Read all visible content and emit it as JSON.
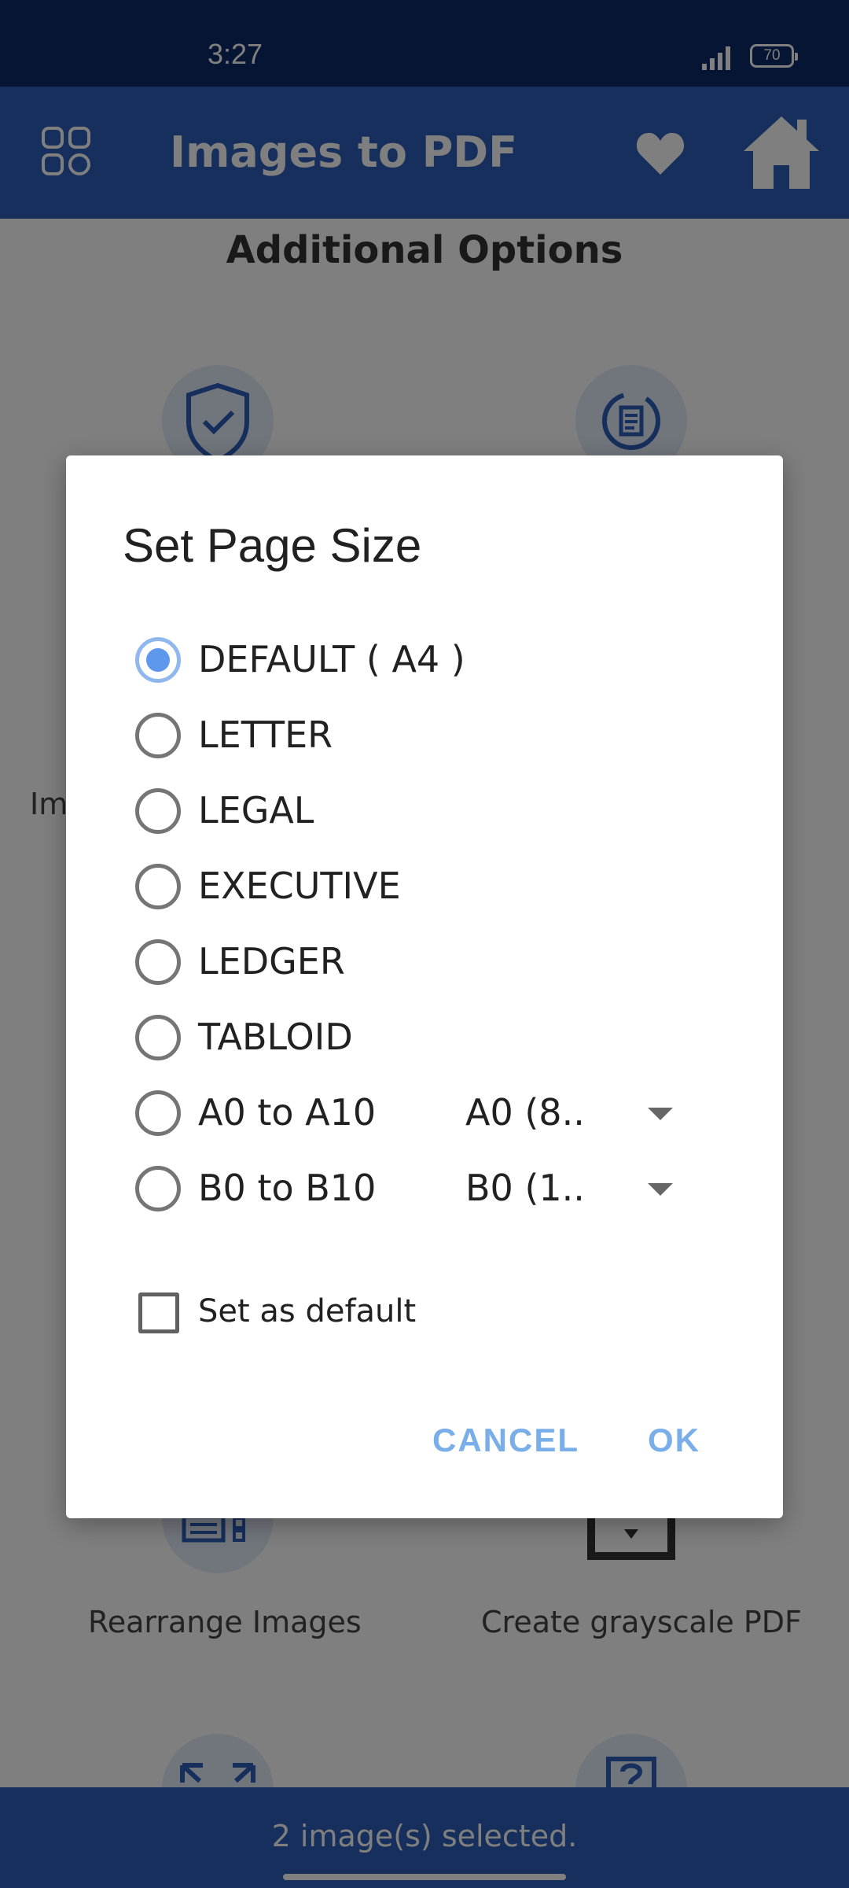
{
  "status_bar": {
    "time": "3:27",
    "battery": "70",
    "icons": [
      "signal-icon",
      "battery-icon"
    ]
  },
  "app_bar": {
    "title": "Images to PDF",
    "icons": [
      "grid-menu-icon",
      "heart-icon",
      "home-icon"
    ]
  },
  "background": {
    "section_title": "Additional Options",
    "options": [
      {
        "label": "Rearrange Images",
        "icon": "rearrange-icon"
      },
      {
        "label": "Create grayscale PDF",
        "icon": "grayscale-icon"
      }
    ],
    "partial_labels": [
      "Im"
    ],
    "selected_text": "2 image(s) selected."
  },
  "dialog": {
    "title": "Set Page Size",
    "options": [
      {
        "label": "DEFAULT ( A4 )",
        "checked": true
      },
      {
        "label": "LETTER",
        "checked": false
      },
      {
        "label": "LEGAL",
        "checked": false
      },
      {
        "label": "EXECUTIVE",
        "checked": false
      },
      {
        "label": "LEDGER",
        "checked": false
      },
      {
        "label": "TABLOID",
        "checked": false
      },
      {
        "label": "A0 to A10",
        "checked": false,
        "dropdown": "A0 (8.."
      },
      {
        "label": "B0 to B10",
        "checked": false,
        "dropdown": "B0 (1.."
      }
    ],
    "checkbox_label": "Set as default",
    "checkbox_checked": false,
    "cancel_label": "CANCEL",
    "ok_label": "OK"
  },
  "colors": {
    "status_bar": "#0b2a66",
    "app_bar": "#2d5fb8",
    "accent": "#5e98ec",
    "button_text": "#7aaee8"
  }
}
